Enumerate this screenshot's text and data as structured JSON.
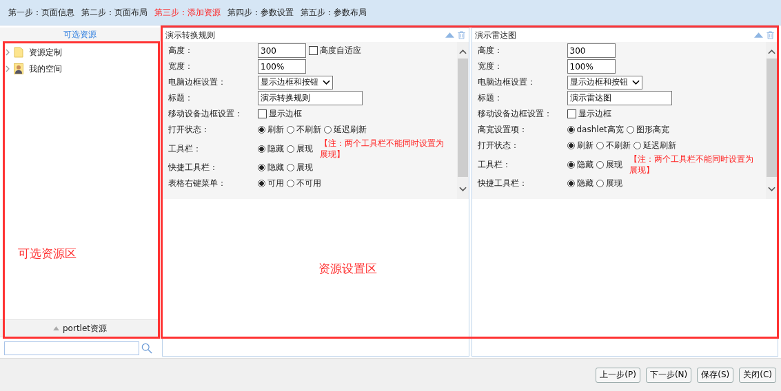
{
  "steps": [
    {
      "label": "第一步：页面信息",
      "selected": false
    },
    {
      "label": "第二步：页面布局",
      "selected": false
    },
    {
      "label": "第三步：添加资源",
      "selected": true
    },
    {
      "label": "第四步：参数设置",
      "selected": false
    },
    {
      "label": "第五步：参数布局",
      "selected": false
    }
  ],
  "resources": {
    "title": "可选资源",
    "tree": [
      {
        "label": "资源定制",
        "kind": "folder"
      },
      {
        "label": "我的空间",
        "kind": "user"
      }
    ],
    "footer": "portlet资源"
  },
  "panels": [
    {
      "title": "演示转换规则",
      "rows": [
        {
          "label": "高度：",
          "kind": "input",
          "value": "300",
          "check": {
            "label": "高度自适应",
            "checked": false
          }
        },
        {
          "label": "宽度：",
          "kind": "input",
          "value": "100%"
        },
        {
          "label": "电脑边框设置：",
          "kind": "select",
          "value": "显示边框和按钮"
        },
        {
          "label": "标题：",
          "kind": "wide-input",
          "value": "演示转换规则"
        },
        {
          "label": "移动设备边框设置：",
          "kind": "checkbox",
          "options": [
            {
              "label": "显示边框",
              "checked": false
            }
          ]
        },
        {
          "label": "打开状态：",
          "kind": "radio",
          "options": [
            {
              "label": "刷新",
              "selected": true
            },
            {
              "label": "不刷新",
              "selected": false
            },
            {
              "label": "延迟刷新",
              "selected": false
            }
          ]
        },
        {
          "label": "工具栏：",
          "kind": "radio",
          "options": [
            {
              "label": "隐藏",
              "selected": true
            },
            {
              "label": "展现",
              "selected": false
            }
          ],
          "note": "【注：两个工具栏不能同时设置为展现】"
        },
        {
          "label": "快捷工具栏：",
          "kind": "radio",
          "options": [
            {
              "label": "隐藏",
              "selected": true
            },
            {
              "label": "展现",
              "selected": false
            }
          ]
        },
        {
          "label": "表格右键菜单：",
          "kind": "radio",
          "options": [
            {
              "label": "可用",
              "selected": true
            },
            {
              "label": "不可用",
              "selected": false
            }
          ]
        }
      ]
    },
    {
      "title": "演示雷达图",
      "rows": [
        {
          "label": "高度：",
          "kind": "input",
          "value": "300"
        },
        {
          "label": "宽度：",
          "kind": "input",
          "value": "100%"
        },
        {
          "label": "电脑边框设置：",
          "kind": "select",
          "value": "显示边框和按钮"
        },
        {
          "label": "标题：",
          "kind": "wide-input",
          "value": "演示雷达图"
        },
        {
          "label": "移动设备边框设置：",
          "kind": "checkbox",
          "options": [
            {
              "label": "显示边框",
              "checked": false
            }
          ]
        },
        {
          "label": "高宽设置项：",
          "kind": "radio",
          "options": [
            {
              "label": "dashlet高宽",
              "selected": true
            },
            {
              "label": "图形高宽",
              "selected": false
            }
          ]
        },
        {
          "label": "打开状态：",
          "kind": "radio",
          "options": [
            {
              "label": "刷新",
              "selected": true
            },
            {
              "label": "不刷新",
              "selected": false
            },
            {
              "label": "延迟刷新",
              "selected": false
            }
          ]
        },
        {
          "label": "工具栏：",
          "kind": "radio",
          "options": [
            {
              "label": "隐藏",
              "selected": true
            },
            {
              "label": "展现",
              "selected": false
            }
          ],
          "note": "【注：两个工具栏不能同时设置为展现】"
        },
        {
          "label": "快捷工具栏：",
          "kind": "radio",
          "options": [
            {
              "label": "隐藏",
              "selected": true
            },
            {
              "label": "展现",
              "selected": false
            }
          ]
        }
      ]
    }
  ],
  "annotations": [
    "可选资源区",
    "资源设置区"
  ],
  "buttons": [
    "上一步(P)",
    "下一步(N)",
    "保存(S)",
    "关闭(C)"
  ]
}
